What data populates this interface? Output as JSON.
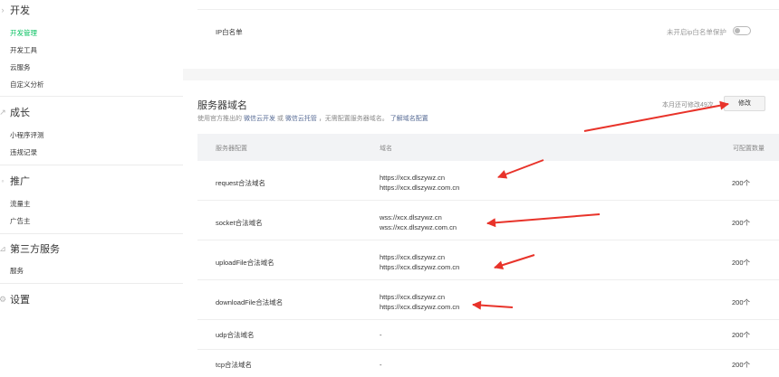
{
  "sidebar": {
    "groups": [
      {
        "title": "开发",
        "items": [
          "开发管理",
          "开发工具",
          "云服务",
          "自定义分析"
        ]
      },
      {
        "title": "成长",
        "items": [
          "小程序评测",
          "违规记录"
        ]
      },
      {
        "title": "推广",
        "items": [
          "流量主",
          "广告主"
        ]
      },
      {
        "title": "第三方服务",
        "items": [
          "服务"
        ]
      },
      {
        "title": "设置",
        "items": []
      }
    ]
  },
  "ip_whitelist": {
    "label": "IP白名单",
    "status": "未开启ip白名单保护"
  },
  "server_domain": {
    "title": "服务器域名",
    "desc_prefix": "使用官方推出的",
    "desc_link1": "微信云开发",
    "desc_or": "或",
    "desc_link2": "微信云托管",
    "desc_middle": "，无需配置服务器域名。",
    "desc_link3": "了解域名配置",
    "remaining": "本月还可修改49次",
    "modify_button": "修改",
    "columns": [
      "服务器配置",
      "域名",
      "可配置数量"
    ],
    "rows": [
      {
        "name": "request合法域名",
        "domains": [
          "https://xcx.dlszywz.cn",
          "https://xcx.dlszywz.com.cn"
        ],
        "count": "200个"
      },
      {
        "name": "socket合法域名",
        "domains": [
          "wss://xcx.dlszywz.cn",
          "wss://xcx.dlszywz.com.cn"
        ],
        "count": "200个"
      },
      {
        "name": "uploadFile合法域名",
        "domains": [
          "https://xcx.dlszywz.cn",
          "https://xcx.dlszywz.com.cn"
        ],
        "count": "200个"
      },
      {
        "name": "downloadFile合法域名",
        "domains": [
          "https://xcx.dlszywz.cn",
          "https://xcx.dlszywz.com.cn"
        ],
        "count": "200个"
      },
      {
        "name": "udp合法域名",
        "domains": [
          "-"
        ],
        "count": "200个"
      },
      {
        "name": "tcp合法域名",
        "domains": [
          "-"
        ],
        "count": "200个"
      }
    ]
  },
  "colors": {
    "accent_green": "#07c160",
    "link_blue": "#576b95",
    "annotation_red": "#e8332a"
  }
}
